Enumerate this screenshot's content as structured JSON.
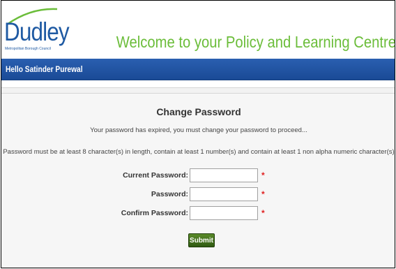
{
  "header": {
    "logo_text": "Dudley",
    "logo_subtext": "Metropolitan Borough Council",
    "welcome": "Welcome to your Policy and Learning Centre"
  },
  "userbar": {
    "greeting": "Hello Satinder Purewal"
  },
  "form": {
    "title": "Change Password",
    "expired_msg": "Your password has expired, you must change your password to proceed...",
    "rules": "Password must be at least 8 character(s) in length, contain at least 1 number(s) and contain at least 1 non alpha numeric character(s)",
    "fields": [
      {
        "label": "Current Password:",
        "value": "",
        "required_mark": "*"
      },
      {
        "label": "Password:",
        "value": "",
        "required_mark": "*"
      },
      {
        "label": "Confirm Password:",
        "value": "",
        "required_mark": "*"
      }
    ],
    "submit_label": "Submit"
  },
  "colors": {
    "brand_blue": "#1f5aa3",
    "welcome_green": "#6bbd3a",
    "userbar_blue": "#1a4a96",
    "required_red": "#e02020",
    "submit_green": "#3e6b1a"
  }
}
